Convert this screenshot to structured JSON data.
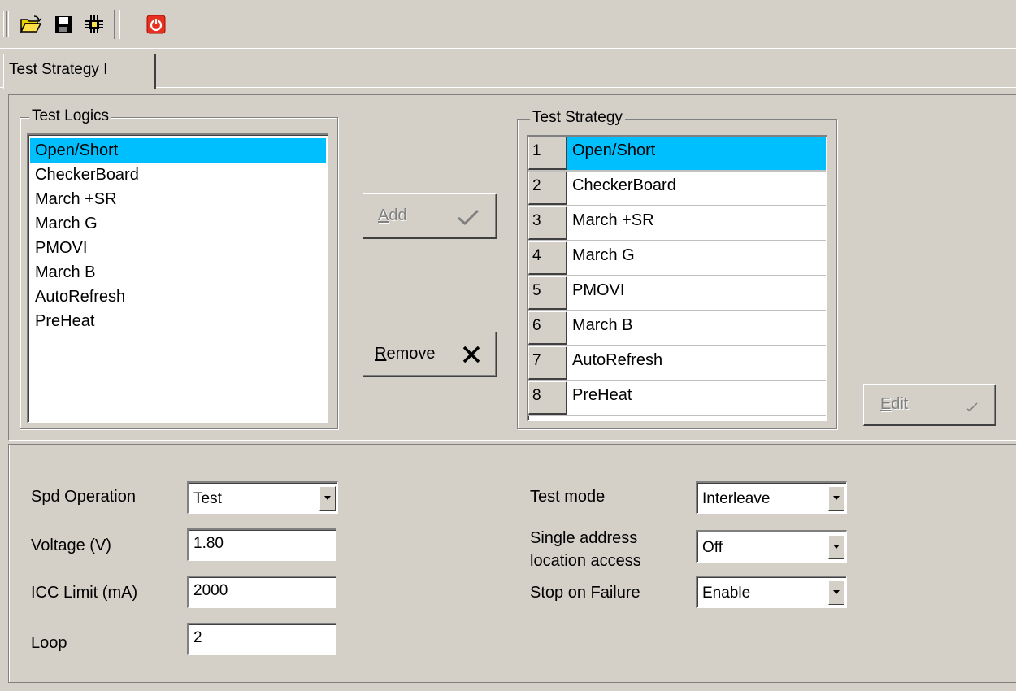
{
  "toolbar": {
    "buttons": [
      {
        "icon": "open-folder-icon"
      },
      {
        "icon": "save-disk-icon"
      },
      {
        "icon": "chip-icon"
      },
      {
        "icon": "power-icon"
      }
    ]
  },
  "tab": {
    "label": "Test Strategy I"
  },
  "test_logics": {
    "title": "Test Logics",
    "items": [
      "Open/Short",
      "CheckerBoard",
      "March +SR",
      "March G",
      "PMOVI",
      "March B",
      "AutoRefresh",
      "PreHeat"
    ],
    "selected_index": 0
  },
  "buttons": {
    "add_label": "Add",
    "add_accel": "A",
    "add_rest": "dd",
    "remove_accel": "R",
    "remove_rest": "emove",
    "edit_accel": "E",
    "edit_rest": "dit"
  },
  "test_strategy": {
    "title": "Test Strategy",
    "rows": [
      {
        "num": "1",
        "name": "Open/Short"
      },
      {
        "num": "2",
        "name": "CheckerBoard"
      },
      {
        "num": "3",
        "name": "March +SR"
      },
      {
        "num": "4",
        "name": "March G"
      },
      {
        "num": "5",
        "name": "PMOVI"
      },
      {
        "num": "6",
        "name": "March B"
      },
      {
        "num": "7",
        "name": "AutoRefresh"
      },
      {
        "num": "8",
        "name": "PreHeat"
      }
    ],
    "selected_index": 0
  },
  "settings": {
    "spd_operation": {
      "label": "Spd Operation",
      "value": "Test"
    },
    "voltage": {
      "label": "Voltage (V)",
      "value": "1.80"
    },
    "icc_limit": {
      "label": "ICC Limit (mA)",
      "value": "2000"
    },
    "loop": {
      "label": "Loop",
      "value": "2"
    },
    "test_mode": {
      "label": "Test mode",
      "value": "Interleave"
    },
    "single_address": {
      "label_line1": "Single address",
      "label_line2": "location access",
      "value": "Off"
    },
    "stop_on_failure": {
      "label": "Stop on Failure",
      "value": "Enable"
    }
  },
  "colors": {
    "face": "#d4d0c8",
    "selection": "#00bfff"
  }
}
